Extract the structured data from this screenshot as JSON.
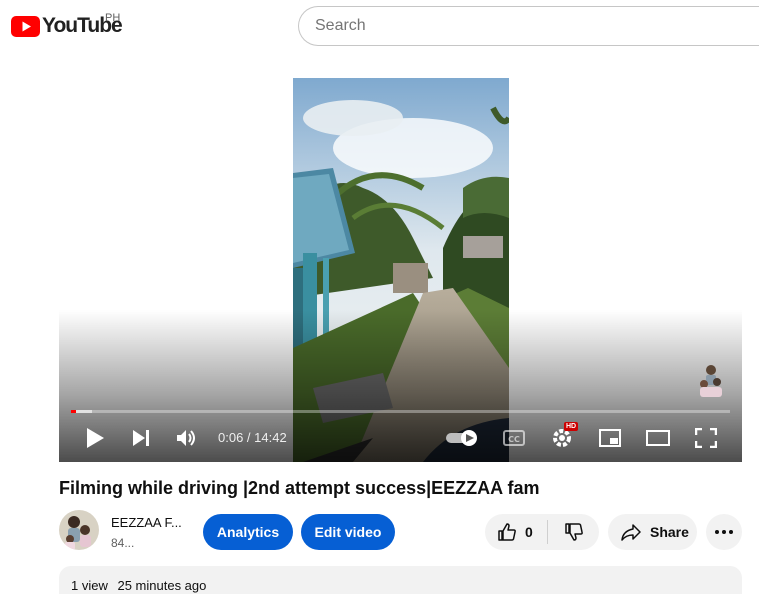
{
  "masthead": {
    "logo_text": "YouTube",
    "country_code": "PH",
    "search_placeholder": "Search"
  },
  "player": {
    "current_time": "0:06",
    "duration": "14:42",
    "time_display": "0:06 / 14:42",
    "progress_fraction": 0.007,
    "hd_badge": "HD",
    "brand_color": "#ff0000"
  },
  "video": {
    "title": "Filming while driving |2nd attempt success|EEZZAA fam"
  },
  "channel": {
    "name": "EEZZAA F...",
    "subscribers": "84..."
  },
  "actions": {
    "analytics_label": "Analytics",
    "edit_label": "Edit video",
    "like_count": "0",
    "share_label": "Share",
    "accent_color": "#065fd4"
  },
  "description": {
    "views": "1 view",
    "published": "25 minutes ago"
  }
}
